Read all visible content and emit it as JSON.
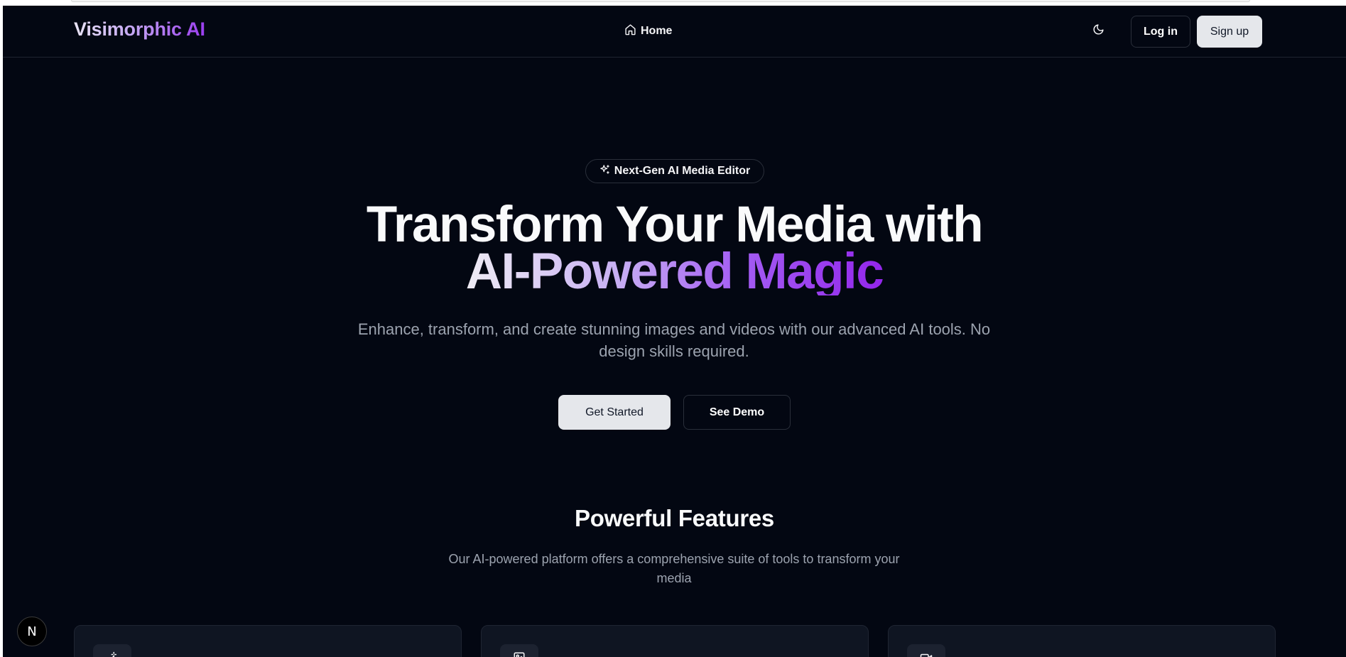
{
  "header": {
    "brand": "Visimorphic AI",
    "nav_home": "Home",
    "login_label": "Log in",
    "signup_label": "Sign up"
  },
  "hero": {
    "badge": "Next-Gen AI Media Editor",
    "title_line1": "Transform Your Media with",
    "title_line2": "AI-Powered Magic",
    "subtitle": "Enhance, transform, and create stunning images and videos with our advanced AI tools. No design skills required.",
    "get_started_label": "Get Started",
    "see_demo_label": "See Demo"
  },
  "features": {
    "title": "Powerful Features",
    "subtitle": "Our AI-powered platform offers a comprehensive suite of tools to transform your media"
  },
  "dev_indicator": {
    "label": "N"
  },
  "colors": {
    "background": "#030712",
    "accent": "#9326eb",
    "muted_text": "#9ca3af",
    "light_button": "#e5e7eb"
  },
  "icons": [
    "home-icon",
    "moon-icon",
    "sparkles-icon",
    "wand-icon",
    "image-icon",
    "video-icon"
  ]
}
